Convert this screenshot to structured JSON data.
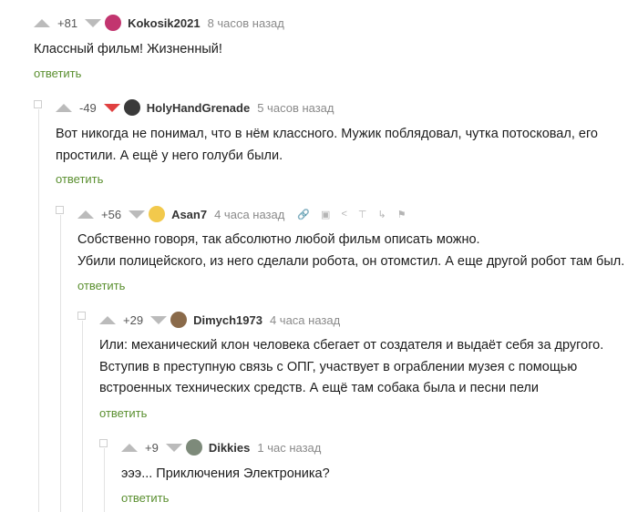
{
  "comments": [
    {
      "rating": "+81",
      "author": "Kokosik2021",
      "time": "8 часов назад",
      "lines": [
        "Классный фильм! Жизненный!"
      ],
      "reply": "ответить",
      "avatar_color": "#c2356f"
    },
    {
      "rating": "-49",
      "author": "HolyHandGrenade",
      "time": "5 часов назад",
      "lines": [
        "Вот никогда не понимал, что в нём классного. Мужик поблядовал, чутка потосковал, его",
        "простили. А ещё у него голуби были."
      ],
      "reply": "ответить",
      "avatar_color": "#3a3a3a",
      "downvote_color": "#e04040"
    },
    {
      "rating": "+56",
      "author": "Asan7",
      "time": "4 часа назад",
      "lines": [
        "Собственно говоря, так абсолютно любой фильм описать можно.",
        "Убили полицейского, из него сделали робота, он отомстил. А еще другой робот там был."
      ],
      "reply": "ответить",
      "avatar_color": "#f2c94c",
      "tools": [
        "link-icon",
        "save-icon",
        "share-icon",
        "pin-icon",
        "branch-icon",
        "flag-icon"
      ]
    },
    {
      "rating": "+29",
      "author": "Dimych1973",
      "time": "4 часа назад",
      "lines": [
        "Или: механический клон человека сбегает от создателя и выдаёт себя за другого.",
        "Вступив в преступную связь с ОПГ, участвует в ограблении музея с помощью",
        "встроенных технических средств. А ещё там собака была и песни пели"
      ],
      "reply": "ответить",
      "avatar_color": "#8a6a4a"
    },
    {
      "rating": "+9",
      "author": "Dikkies",
      "time": "1 час назад",
      "lines": [
        "эээ... Приключения Электроника?"
      ],
      "reply": "ответить",
      "avatar_color": "#7d8a7a"
    }
  ],
  "colors": {
    "accent_link": "#5a8f2f",
    "vote_arrow": "#bbbbbb"
  }
}
